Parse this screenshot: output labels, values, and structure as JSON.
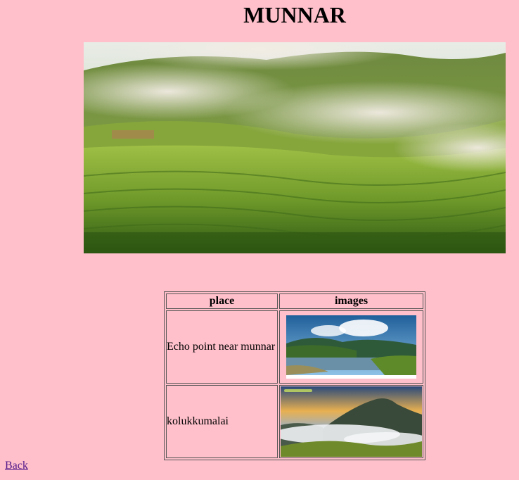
{
  "page": {
    "title": "MUNNAR",
    "hero_image": "munnar-tea-plantation-hills"
  },
  "table": {
    "headers": [
      "place",
      "images"
    ],
    "rows": [
      {
        "place": "Echo point near munnar",
        "image": "echo-point-lake-mountains"
      },
      {
        "place": "kolukkumalai",
        "image": "kolukkumalai-peak-clouds"
      }
    ]
  },
  "nav": {
    "back_label": "Back"
  },
  "colors": {
    "background": "#ffc0cb",
    "link": "#551a8b"
  }
}
